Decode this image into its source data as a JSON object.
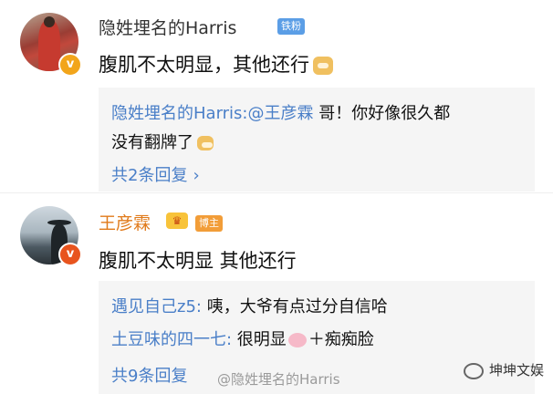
{
  "comments": [
    {
      "user": "隐姓埋名的Harris",
      "tag": "铁粉",
      "text": "腹肌不太明显，其他还行",
      "replies": [
        {
          "name": "隐姓埋名的Harris:",
          "mention": "@王彦霖",
          "line1": " 哥！你好像很久都",
          "line2": "没有翻牌了"
        }
      ],
      "more": "共2条回复"
    },
    {
      "user": "王彦霖",
      "tag": "博主",
      "text": "腹肌不太明显 其他还行",
      "replies": [
        {
          "name": "遇见自己z5:",
          "text": " 咦，大爷有点过分自信哈"
        },
        {
          "name": "土豆味的四一七:",
          "text_before": " 很明显",
          "text_after": "＋痴痴脸"
        }
      ],
      "more": "共9条回复"
    }
  ],
  "watermark": "@隐姓埋名的Harris",
  "source_label": "坤坤文娱"
}
